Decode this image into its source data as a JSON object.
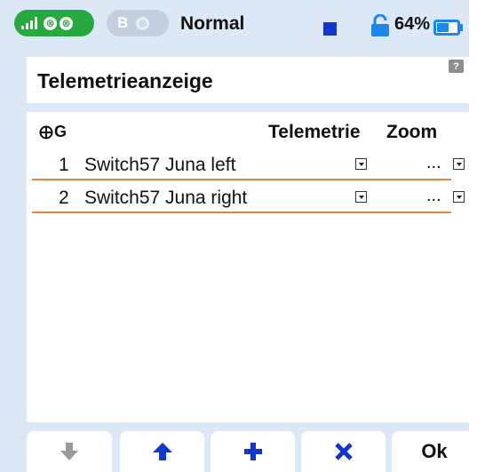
{
  "statusbar": {
    "receiver_x": "⊗",
    "b_label": "B",
    "b_x": "⊗",
    "mode": "Normal",
    "battery_percent": "64%",
    "battery_level": 0.64,
    "colors": {
      "receiver": "#27a93f",
      "blue_square": "#1236c9",
      "battery": "#1f86e8"
    }
  },
  "header": {
    "title": "Telemetrieanzeige",
    "help_icon": "?"
  },
  "table": {
    "columns": {
      "g": "G",
      "telemetrie": "Telemetrie",
      "zoom": "Zoom"
    },
    "rows": [
      {
        "num": "1",
        "name": "Switch57 Juna left",
        "zoom_value": "..."
      },
      {
        "num": "2",
        "name": "Switch57 Juna right",
        "zoom_value": "..."
      }
    ],
    "row_separator_color": "#e0843e"
  },
  "buttons": {
    "down_icon": "arrow-down-icon",
    "up_icon": "arrow-up-icon",
    "add_icon": "plus-icon",
    "delete_icon": "x-icon",
    "ok_label": "Ok"
  }
}
